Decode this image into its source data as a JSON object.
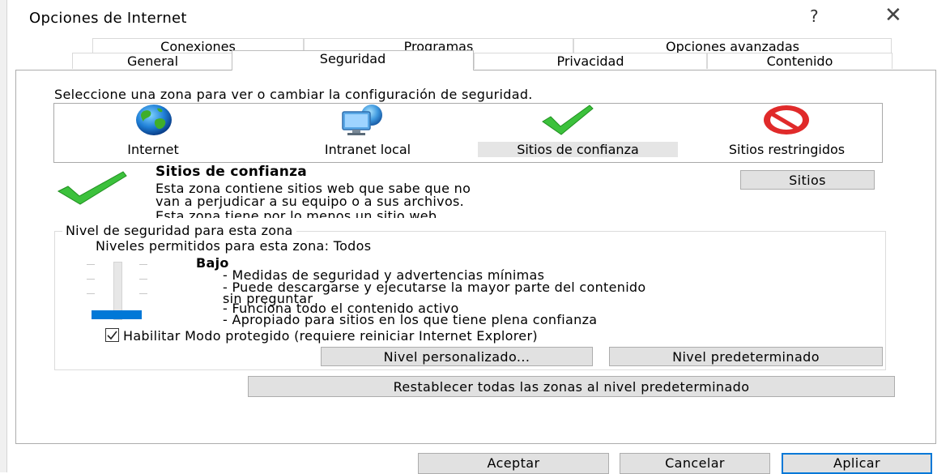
{
  "window": {
    "title": "Opciones de Internet",
    "help_glyph": "?",
    "close_glyph": "✕"
  },
  "tabs": {
    "row1": [
      "Conexiones",
      "Programas",
      "Opciones avanzadas"
    ],
    "row2": [
      "General",
      "Seguridad",
      "Privacidad",
      "Contenido"
    ],
    "active": "Seguridad"
  },
  "security": {
    "instruction": "Seleccione una zona para ver o cambiar la configuración de seguridad.",
    "zones": [
      {
        "label": "Internet",
        "icon": "globe-icon"
      },
      {
        "label": "Intranet local",
        "icon": "intranet-icon"
      },
      {
        "label": "Sitios de confianza",
        "icon": "checkmark-icon",
        "selected": true
      },
      {
        "label": "Sitios restringidos",
        "icon": "no-entry-icon"
      }
    ],
    "zone_title": "Sitios de confianza",
    "zone_desc_line1": "Esta zona contiene sitios web que sabe que no",
    "zone_desc_line2": "van a perjudicar a su equipo o a sus archivos.",
    "zone_note": "Esta zona tiene por lo menos un sitio web.",
    "sites_button": "Sitios",
    "level_group_label": "Nivel de seguridad para esta zona",
    "allowed_levels": "Niveles permitidos para esta zona: Todos",
    "level_name": "Bajo",
    "level_lines": [
      "- Medidas de seguridad y advertencias mínimas",
      "- Puede descargarse y ejecutarse la mayor parte del contenido",
      "sin preguntar",
      "- Funciona todo el contenido activo",
      "- Apropiado para sitios en los que tiene plena confianza"
    ],
    "slider_level": 0,
    "protected_mode_label": "Habilitar Modo protegido (requiere reiniciar Internet Explorer)",
    "protected_mode_checked": true,
    "custom_level_button": "Nivel personalizado...",
    "default_level_button": "Nivel predeterminado",
    "reset_all_button": "Restablecer todas las zonas al nivel predeterminado"
  },
  "footer": {
    "ok": "Aceptar",
    "cancel": "Cancelar",
    "apply": "Aplicar"
  },
  "colors": {
    "accent": "#0078d7",
    "button_bg": "#e1e1e1",
    "selection_bg": "#e5e5e5"
  }
}
